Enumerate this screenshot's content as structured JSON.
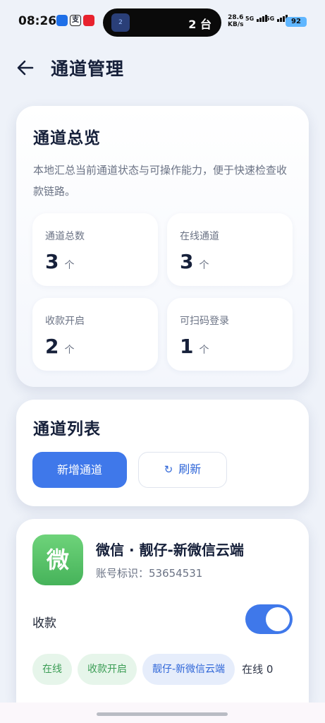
{
  "status_bar": {
    "time": "08:26",
    "app_icon_2": "支",
    "island_icon": "2",
    "island_text": "2 台",
    "net_speed_value": "28.6",
    "net_speed_unit": "KB/s",
    "sig1_label": "5G",
    "sig2_label": "5G",
    "battery": "92"
  },
  "header": {
    "title": "通道管理"
  },
  "overview": {
    "title": "通道总览",
    "desc": "本地汇总当前通道状态与可操作能力，便于快速检查收款链路。",
    "stats": [
      {
        "label": "通道总数",
        "value": "3",
        "unit": "个"
      },
      {
        "label": "在线通道",
        "value": "3",
        "unit": "个"
      },
      {
        "label": "收款开启",
        "value": "2",
        "unit": "个"
      },
      {
        "label": "可扫码登录",
        "value": "1",
        "unit": "个"
      }
    ]
  },
  "channel_list": {
    "title": "通道列表",
    "add_button": "新增通道",
    "refresh_button": "刷新"
  },
  "channel": {
    "logo_text": "微",
    "name": "微信 · 靓仔-新微信云端",
    "account": "账号标识：53654531",
    "receive_label": "收款",
    "receive_enabled": true,
    "tags": [
      "在线",
      "收款开启",
      "靓仔-新微信云端"
    ],
    "status_text": "在线 0"
  },
  "colors": {
    "accent": "#3f78ea",
    "background": "#eef2f9",
    "tag_green": "#3b9d55",
    "wechat_green": "#4fbd60"
  },
  "icons": {
    "back": "arrow-left-icon",
    "refresh": "refresh-icon"
  }
}
